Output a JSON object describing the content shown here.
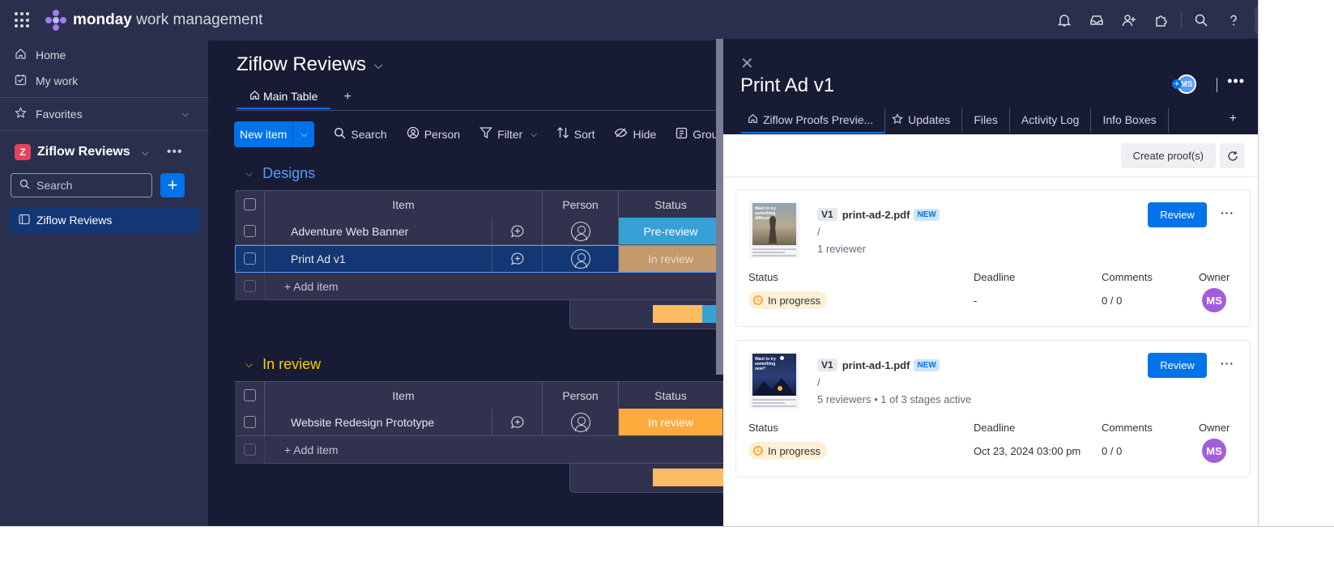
{
  "app": {
    "brand_bold": "monday",
    "brand_rest": "work management",
    "user_initials": "MS",
    "colors": {
      "topbar": "#292f4c",
      "board_bg": "#181b34",
      "accent": "#0073ea"
    }
  },
  "topbar_icons": [
    "bell-icon",
    "inbox-icon",
    "invite-members-icon",
    "apps-icon",
    "search-icon",
    "help-icon"
  ],
  "sidebar": {
    "nav": [
      {
        "label": "Home",
        "icon": "home-icon"
      },
      {
        "label": "My work",
        "icon": "calendar-check-icon"
      }
    ],
    "favorites": "Favorites",
    "workspace": {
      "badge": "Z",
      "name": "Ziflow Reviews"
    },
    "search_placeholder": "Search",
    "boards": [
      "Ziflow Reviews"
    ]
  },
  "board": {
    "title": "Ziflow Reviews",
    "tabs": [
      "Main Table"
    ],
    "toolbar": {
      "new_item": "New item",
      "search": "Search",
      "person": "Person",
      "filter": "Filter",
      "sort": "Sort",
      "hide": "Hide",
      "group": "Grou"
    },
    "columns": {
      "item": "Item",
      "person": "Person",
      "status": "Status"
    },
    "groups": [
      {
        "title": "Designs",
        "color": "#579bfc",
        "rows": [
          {
            "item": "Adventure Web Banner",
            "status": "Pre-review",
            "status_color": "#37a1d6"
          },
          {
            "item": "Print Ad v1",
            "status": "In review",
            "status_color": "#c29a6b"
          }
        ],
        "add_item": "+ Add item",
        "summary": [
          {
            "color": "#fdbc64",
            "share": 0.5
          },
          {
            "color": "#37a1d6",
            "share": 0.5
          }
        ]
      },
      {
        "title": "In review",
        "color": "#ffcb00",
        "rows": [
          {
            "item": "Website Redesign Prototype",
            "status": "In review",
            "status_color": "#fdab3d"
          }
        ],
        "add_item": "+ Add item",
        "summary": [
          {
            "color": "#fdbc64",
            "share": 1.0
          }
        ]
      }
    ]
  },
  "panel": {
    "title": "Print Ad v1",
    "avatar_initials": "MS",
    "tabs": [
      "Ziflow Proofs Previe...",
      "Updates",
      "Files",
      "Activity Log",
      "Info Boxes"
    ],
    "create_label": "Create proof(s)",
    "labels": {
      "status": "Status",
      "deadline": "Deadline",
      "comments": "Comments",
      "owner": "Owner"
    },
    "proofs": [
      {
        "version": "V1",
        "file": "print-ad-2.pdf",
        "badge": "NEW",
        "path": "/",
        "reviewers": "1 reviewer",
        "review_label": "Review",
        "status": "In progress",
        "deadline": "-",
        "comments": "0 / 0",
        "owner": "MS",
        "thumb_text": "Want to try something different?"
      },
      {
        "version": "V1",
        "file": "print-ad-1.pdf",
        "badge": "NEW",
        "path": "/",
        "reviewers": "5 reviewers • 1 of 3 stages active",
        "review_label": "Review",
        "status": "In progress",
        "deadline": "Oct 23, 2024 03:00 pm",
        "comments": "0 / 0",
        "owner": "MS",
        "thumb_text": "Want to try something new?"
      }
    ]
  }
}
